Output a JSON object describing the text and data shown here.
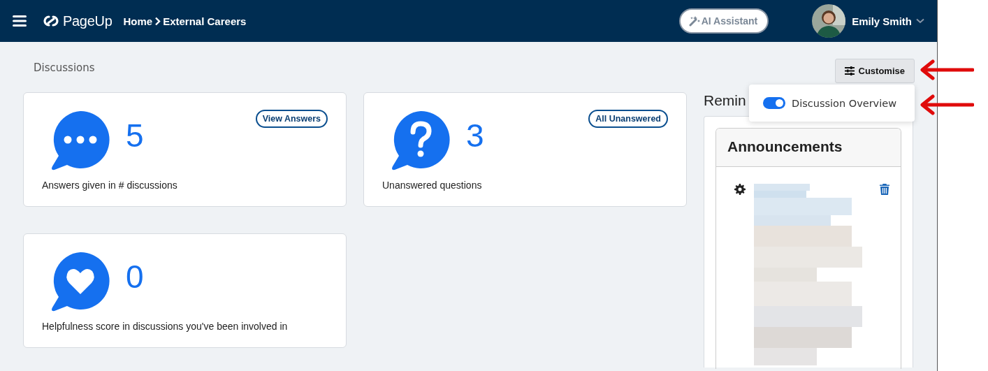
{
  "header": {
    "brand": "PageUp",
    "breadcrumb": [
      {
        "label": "Home"
      },
      {
        "label": "External Careers"
      }
    ],
    "ai_button": "AI Assistant",
    "user": {
      "name": "Emily Smith"
    }
  },
  "page": {
    "title": "Discussions"
  },
  "customise": {
    "label": "Customise",
    "options": [
      {
        "label": "Discussion Overview",
        "on": true
      }
    ]
  },
  "cards": [
    {
      "kind": "ellipsis",
      "value": "5",
      "action": "View Answers",
      "caption": "Answers given in # discussions"
    },
    {
      "kind": "question",
      "value": "3",
      "action": "All Unanswered",
      "caption": "Unanswered questions"
    },
    {
      "kind": "heart",
      "value": "0",
      "caption": "Helpfulness score in discussions you've been involved in"
    }
  ],
  "reminders": {
    "heading": "Remin",
    "panels": [
      {
        "title": "Announcements",
        "kind": "picture"
      }
    ]
  },
  "annotations": [
    {
      "kind": "arrow"
    },
    {
      "kind": "arrow"
    }
  ]
}
